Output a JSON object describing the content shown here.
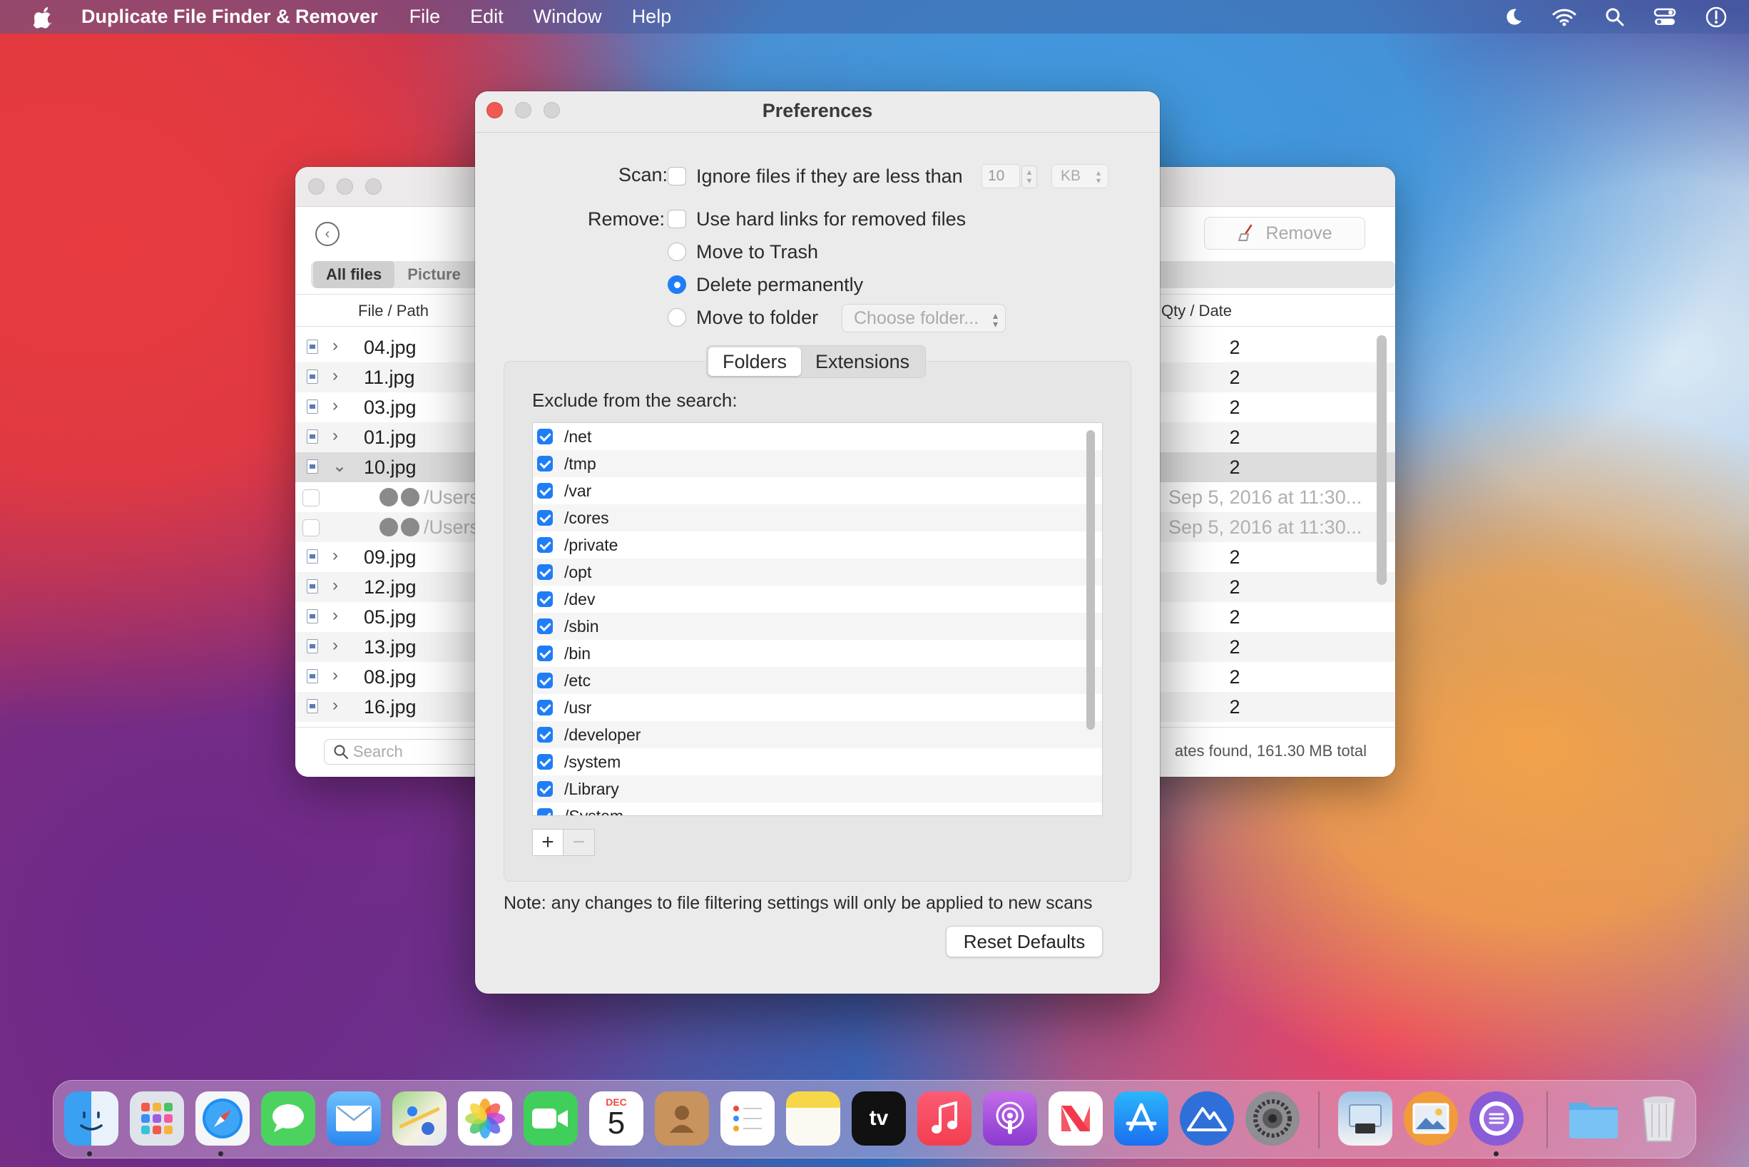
{
  "menubar": {
    "app_name": "Duplicate File Finder & Remover",
    "items": [
      "File",
      "Edit",
      "Window",
      "Help"
    ],
    "right_icons": [
      "moon-icon",
      "wifi-icon",
      "spotlight-search-icon",
      "control-center-icon",
      "siri-icon"
    ]
  },
  "main_window": {
    "remove_label": "Remove",
    "tabs": [
      "All files",
      "Picture"
    ],
    "columns": {
      "file": "File / Path",
      "qty": "Qty / Date"
    },
    "rows": [
      {
        "name": "04.jpg",
        "qty": "2"
      },
      {
        "name": "11.jpg",
        "qty": "2"
      },
      {
        "name": "03.jpg",
        "qty": "2"
      },
      {
        "name": "01.jpg",
        "qty": "2"
      },
      {
        "name": "10.jpg",
        "qty": "2"
      }
    ],
    "sub_rows": [
      {
        "path": "/Users",
        "date": "Sep 5, 2016 at 11:30..."
      },
      {
        "path": "/Users",
        "date": "Sep 5, 2016 at 11:30..."
      }
    ],
    "rows_after": [
      {
        "name": "09.jpg",
        "qty": "2"
      },
      {
        "name": "12.jpg",
        "qty": "2"
      },
      {
        "name": "05.jpg",
        "qty": "2"
      },
      {
        "name": "13.jpg",
        "qty": "2"
      },
      {
        "name": "08.jpg",
        "qty": "2"
      },
      {
        "name": "16.jpg",
        "qty": "2"
      }
    ],
    "search_placeholder": "Search",
    "status": "ates found, 161.30 MB total"
  },
  "prefs": {
    "title": "Preferences",
    "scan_label": "Scan:",
    "ignore_text": "Ignore files if they are less than",
    "size_value": "10",
    "unit": "KB",
    "remove_label": "Remove:",
    "hard_links_text": "Use hard links for removed files",
    "move_trash": "Move to Trash",
    "delete_perm": "Delete permanently",
    "move_folder": "Move to folder",
    "choose_folder": "Choose folder...",
    "tabs": [
      "Folders",
      "Extensions"
    ],
    "exclude_label": "Exclude from the search:",
    "folders": [
      "/net",
      "/tmp",
      "/var",
      "/cores",
      "/private",
      "/opt",
      "/dev",
      "/sbin",
      "/bin",
      "/etc",
      "/usr",
      "/developer",
      "/system",
      "/Library",
      "/System"
    ],
    "plus": "+",
    "minus": "−",
    "note": "Note: any changes to file filtering settings will only be applied to new scans",
    "reset_label": "Reset Defaults"
  },
  "dock": {
    "apps": [
      "finder-icon",
      "launchpad-icon",
      "safari-icon",
      "messages-icon",
      "mail-icon",
      "maps-icon",
      "photos-icon",
      "facetime-icon",
      "calendar-icon",
      "contacts-icon",
      "reminders-icon",
      "notes-icon",
      "apple-tv-icon",
      "music-icon",
      "podcasts-icon",
      "news-icon",
      "app-store-icon",
      "altitude-icon",
      "system-preferences-icon",
      "preview-icon",
      "image-viewer-icon",
      "duplicate-finder-icon",
      "downloads-folder-icon",
      "trash-icon"
    ],
    "calendar_month": "DEC",
    "calendar_day": "5",
    "tv_label": "tv"
  }
}
